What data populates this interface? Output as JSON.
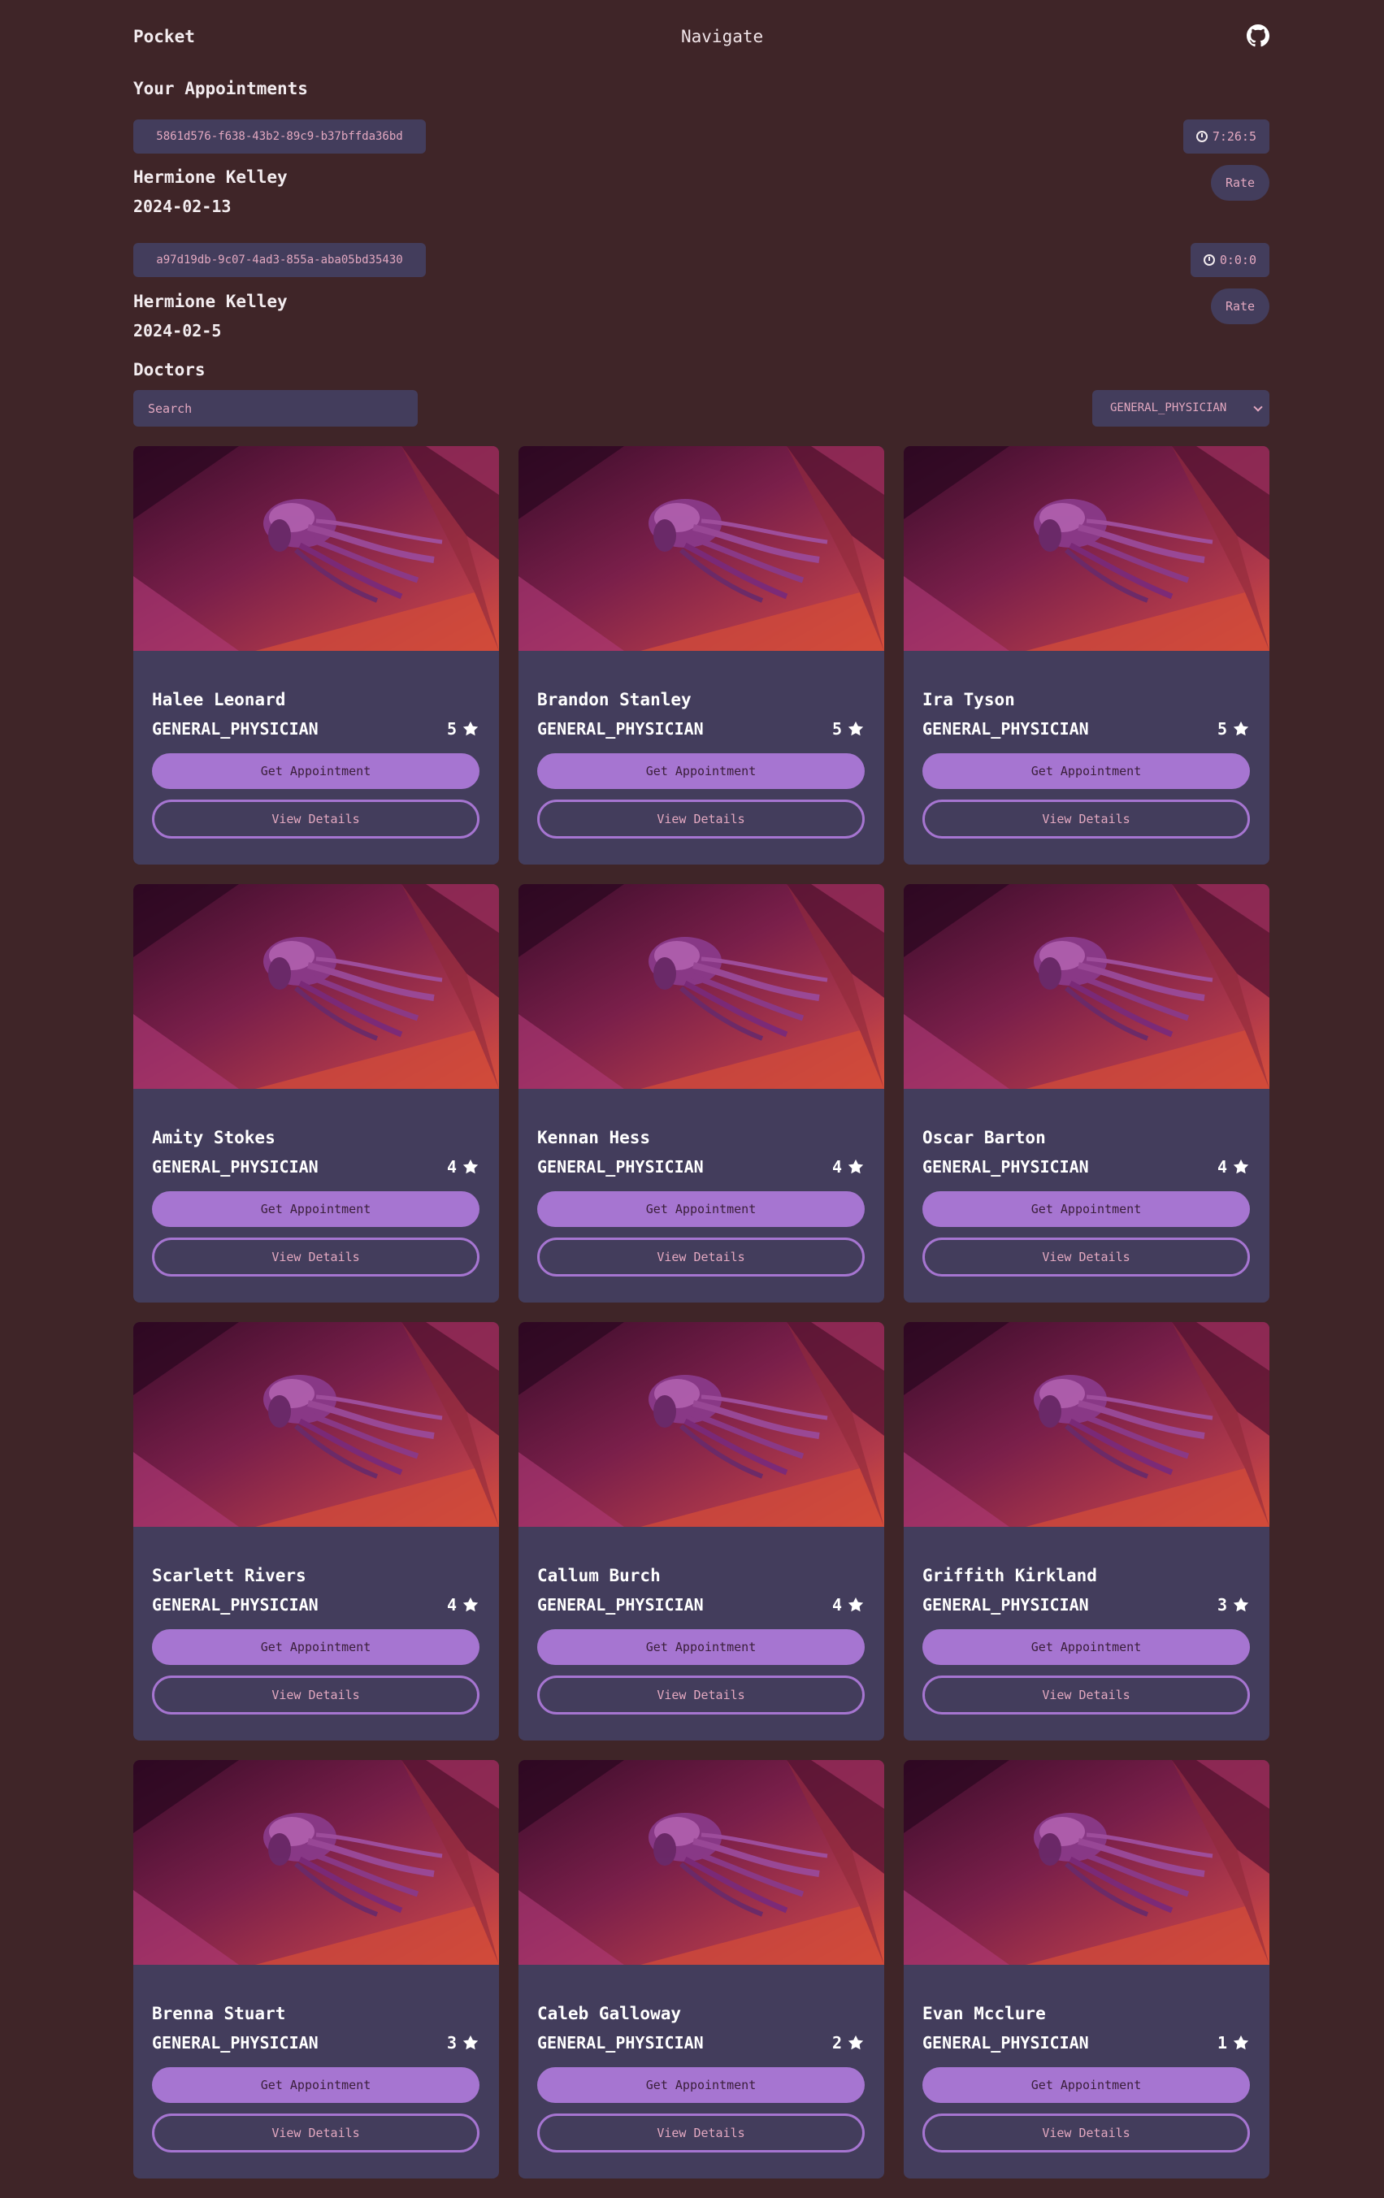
{
  "navbar": {
    "brand": "Pocket",
    "center": "Navigate"
  },
  "appointments": {
    "title": "Your Appointments",
    "items": [
      {
        "id": "5861d576-f638-43b2-89c9-b37bffda36bd",
        "timer": "7:26:5",
        "name": "Hermione Kelley",
        "date": "2024-02-13",
        "rate_label": "Rate"
      },
      {
        "id": "a97d19db-9c07-4ad3-855a-aba05bd35430",
        "timer": "0:0:0",
        "name": "Hermione Kelley",
        "date": "2024-02-5",
        "rate_label": "Rate"
      }
    ]
  },
  "doctors": {
    "title": "Doctors",
    "search_placeholder": "Search",
    "filter_value": "GENERAL_PHYSICIAN",
    "get_label": "Get Appointment",
    "details_label": "View Details",
    "list": [
      {
        "name": "Halee Leonard",
        "specialty": "GENERAL_PHYSICIAN",
        "rating": "5"
      },
      {
        "name": "Brandon Stanley",
        "specialty": "GENERAL_PHYSICIAN",
        "rating": "5"
      },
      {
        "name": "Ira Tyson",
        "specialty": "GENERAL_PHYSICIAN",
        "rating": "5"
      },
      {
        "name": "Amity Stokes",
        "specialty": "GENERAL_PHYSICIAN",
        "rating": "4"
      },
      {
        "name": "Kennan Hess",
        "specialty": "GENERAL_PHYSICIAN",
        "rating": "4"
      },
      {
        "name": "Oscar Barton",
        "specialty": "GENERAL_PHYSICIAN",
        "rating": "4"
      },
      {
        "name": "Scarlett Rivers",
        "specialty": "GENERAL_PHYSICIAN",
        "rating": "4"
      },
      {
        "name": "Callum Burch",
        "specialty": "GENERAL_PHYSICIAN",
        "rating": "4"
      },
      {
        "name": "Griffith Kirkland",
        "specialty": "GENERAL_PHYSICIAN",
        "rating": "3"
      },
      {
        "name": "Brenna Stuart",
        "specialty": "GENERAL_PHYSICIAN",
        "rating": "3"
      },
      {
        "name": "Caleb Galloway",
        "specialty": "GENERAL_PHYSICIAN",
        "rating": "2"
      },
      {
        "name": "Evan Mcclure",
        "specialty": "GENERAL_PHYSICIAN",
        "rating": "1"
      }
    ]
  },
  "icons": {
    "github": "github-icon",
    "clock": "clock-icon",
    "star": "star-icon",
    "chevron": "chevron-down-icon",
    "card_image": "jellyfish-wallpaper"
  },
  "colors": {
    "background": "#3f2528",
    "surface": "#433d5c",
    "accent": "#a675d1",
    "muted_text": "#e3a8c0"
  }
}
